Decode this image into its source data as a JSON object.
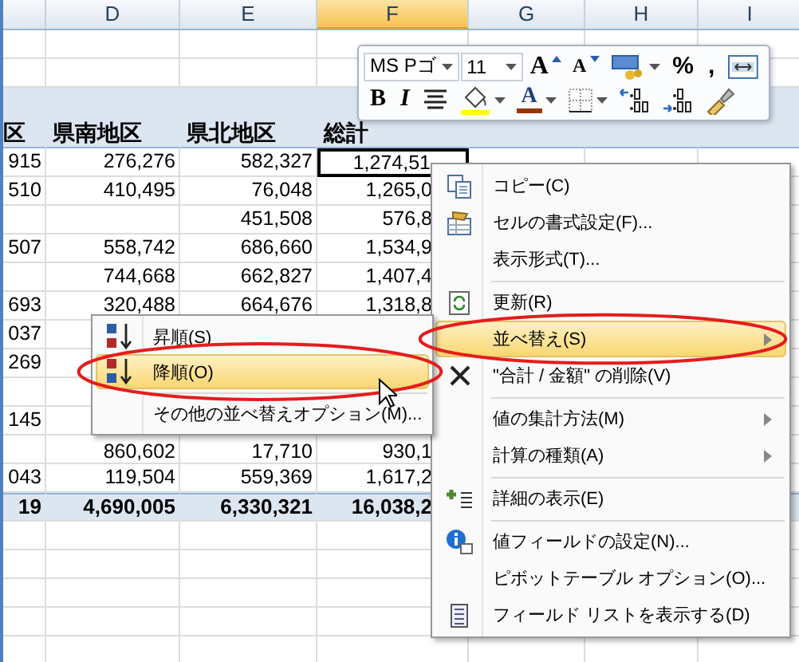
{
  "columns": [
    {
      "selected": false
    },
    {
      "label": "D",
      "selected": false
    },
    {
      "label": "E",
      "selected": false
    },
    {
      "label": "F",
      "selected": true
    },
    {
      "label": "G",
      "selected": false
    },
    {
      "label": "H",
      "selected": false
    },
    {
      "label": "I",
      "selected": false
    }
  ],
  "pivot": {
    "header": {
      "c": "区",
      "d": "県南地区",
      "e": "県北地区",
      "f": "総計"
    },
    "rows": [
      {
        "c": "915",
        "d": "276,276",
        "e": "582,327",
        "f": "1,274,51",
        "f_selected": true
      },
      {
        "c": "510",
        "d": "410,495",
        "e": "76,048",
        "f": "1,265,0",
        "f_selected": false
      },
      {
        "e": "451,508",
        "f": "576,8",
        "f_selected": false
      },
      {
        "c": "507",
        "d": "558,742",
        "e": "686,660",
        "f": "1,534,9",
        "f_selected": false
      },
      {
        "d": "744,668",
        "e": "662,827",
        "f": "1,407,4",
        "f_selected": false
      },
      {
        "c": "693",
        "d": "320,488",
        "e": "664,676",
        "f": "1,318,8",
        "f_selected": false
      },
      {
        "c": "037"
      },
      {
        "c": "269"
      },
      {},
      {
        "c": "145"
      },
      {
        "d": "860,602",
        "e": "17,710",
        "f": "930,1",
        "f_selected": false
      },
      {
        "c": "043",
        "d": "119,504",
        "e": "559,369",
        "f": "1,617,2",
        "f_selected": false
      }
    ],
    "total": {
      "c": "19",
      "d": "4,690,005",
      "e": "6,330,321",
      "f": "16,038,2"
    }
  },
  "mini_toolbar": {
    "top_row": [
      {
        "kind": "combo",
        "label": "MS Pゴ"
      },
      {
        "kind": "combo",
        "label": "11"
      },
      {
        "kind": "grow",
        "label": "A"
      },
      {
        "kind": "shrink",
        "label": "A"
      },
      {
        "kind": "accounting"
      },
      {
        "kind": "text",
        "label": "%"
      },
      {
        "kind": "text",
        "label": ","
      },
      {
        "kind": "merge"
      }
    ],
    "bottom_row": [
      {
        "kind": "bold",
        "label": "B"
      },
      {
        "kind": "italic",
        "label": "I"
      },
      {
        "kind": "center"
      },
      {
        "kind": "fill",
        "color": "#ffff00"
      },
      {
        "kind": "fontcolor",
        "label": "A",
        "color": "#993300"
      },
      {
        "kind": "borders"
      },
      {
        "kind": "incdec"
      },
      {
        "kind": "decdec"
      },
      {
        "kind": "painter"
      }
    ]
  },
  "context_menu": {
    "items": [
      {
        "label": "コピー(C)",
        "separator_before": false,
        "submenu": false,
        "selected": false,
        "circled": false
      },
      {
        "label": "セルの書式設定(F)...",
        "separator_before": false,
        "submenu": false,
        "selected": false,
        "circled": false
      },
      {
        "label": "表示形式(T)...",
        "separator_before": false,
        "submenu": false,
        "selected": false,
        "circled": false
      },
      {
        "label": "更新(R)",
        "separator_before": true,
        "submenu": false,
        "selected": false,
        "circled": false
      },
      {
        "label": "並べ替え(S)",
        "separator_before": false,
        "submenu": true,
        "selected": true,
        "circled": true
      },
      {
        "label": "\"合計 / 金額\" の削除(V)",
        "separator_before": false,
        "submenu": false,
        "selected": false,
        "circled": false
      },
      {
        "label": "値の集計方法(M)",
        "separator_before": true,
        "submenu": true,
        "selected": false,
        "circled": false
      },
      {
        "label": "計算の種類(A)",
        "separator_before": false,
        "submenu": true,
        "selected": false,
        "circled": false
      },
      {
        "label": "詳細の表示(E)",
        "separator_before": true,
        "submenu": false,
        "selected": false,
        "circled": false
      },
      {
        "label": "値フィールドの設定(N)...",
        "separator_before": true,
        "submenu": false,
        "selected": false,
        "circled": false
      },
      {
        "label": "ピボットテーブル オプション(O)...",
        "separator_before": false,
        "submenu": false,
        "selected": false,
        "circled": false
      },
      {
        "label": "フィールド リストを表示する(D)",
        "separator_before": false,
        "submenu": false,
        "selected": false,
        "circled": false
      }
    ]
  },
  "sort_submenu": {
    "items": [
      {
        "label": "昇順(S)",
        "separator_before": false,
        "selected": false,
        "circled": false
      },
      {
        "label": "降順(O)",
        "separator_before": false,
        "selected": true,
        "circled": true
      },
      {
        "label": "その他の並べ替えオプション(M)...",
        "separator_before": true,
        "selected": false,
        "circled": false
      }
    ]
  }
}
